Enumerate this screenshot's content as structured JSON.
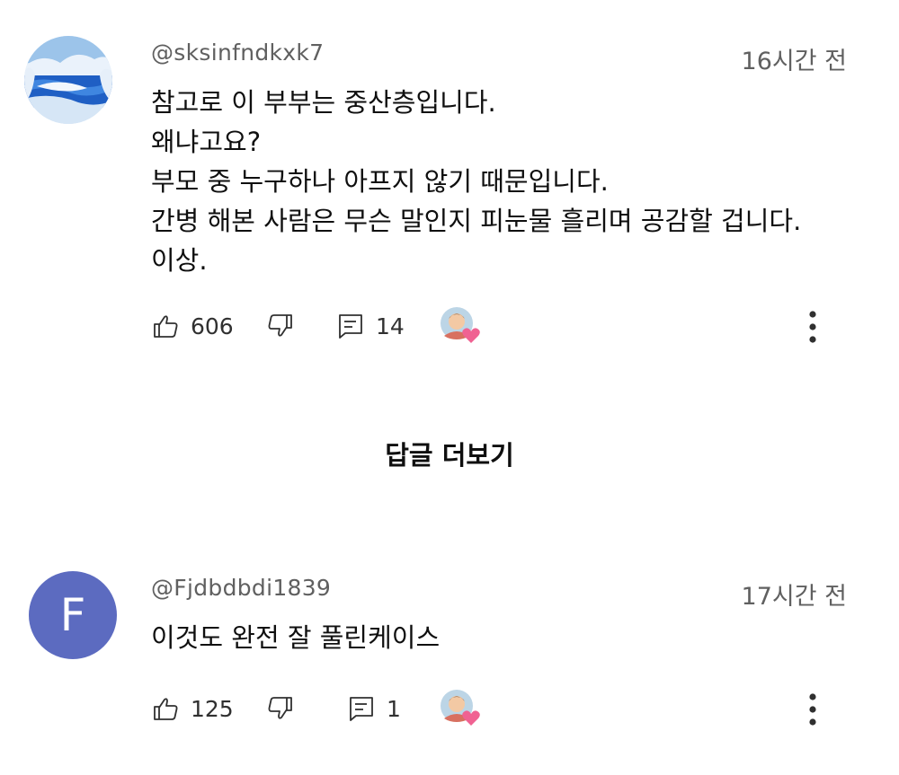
{
  "comments": [
    {
      "handle": "@sksinfndkxk7",
      "time": "16시간 전",
      "lines": [
        "참고로 이 부부는 중산층입니다.",
        "왜냐고요?",
        "부모 중 누구하나 아프지 않기 때문입니다.",
        "간병 해본 사람은 무슨 말인지 피눈물 흘리며 공감할 겁니다.",
        "이상."
      ],
      "likes": "606",
      "replies": "14",
      "avatar": "landscape-avatar"
    },
    {
      "handle": "@Fjdbdbdi1839",
      "time": "17시간 전",
      "lines": [
        "이것도 완전 잘 풀린케이스"
      ],
      "likes": "125",
      "replies": "1",
      "avatar_letter": "F",
      "avatar_color": "#5c6bc0"
    }
  ],
  "more_replies_label": "답글 더보기",
  "icons": [
    "thumb-up-icon",
    "thumb-down-icon",
    "reply-icon",
    "creator-heart-icon",
    "more-vert-icon"
  ],
  "colors": {
    "text": "#0f0f0f",
    "secondary": "#606060",
    "heart": "#f06292"
  }
}
